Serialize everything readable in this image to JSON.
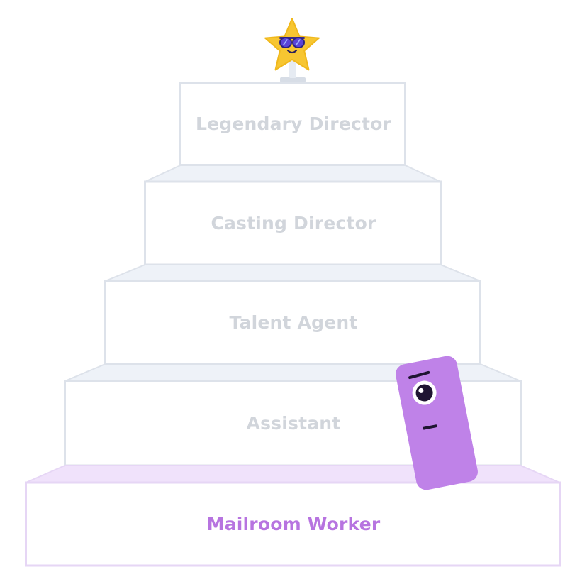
{
  "tiers": [
    {
      "label": "Legendary Director",
      "state": "inactive"
    },
    {
      "label": "Casting Director",
      "state": "inactive"
    },
    {
      "label": "Talent Agent",
      "state": "inactive"
    },
    {
      "label": "Assistant",
      "state": "inactive"
    },
    {
      "label": "Mailroom Worker",
      "state": "current"
    }
  ],
  "colors": {
    "inactive_text": "#d1d5db",
    "inactive_border": "#dde2ea",
    "inactive_ledge": "#eef2f8",
    "active_text": "#b774e0",
    "active_border": "#e6d6f5",
    "active_ledge": "#f0e2fb",
    "character_body": "#bf82e8",
    "star": "#f7c631"
  },
  "icons": {
    "trophy": "star-with-sunglasses-icon",
    "character": "purple-block-character-icon"
  }
}
